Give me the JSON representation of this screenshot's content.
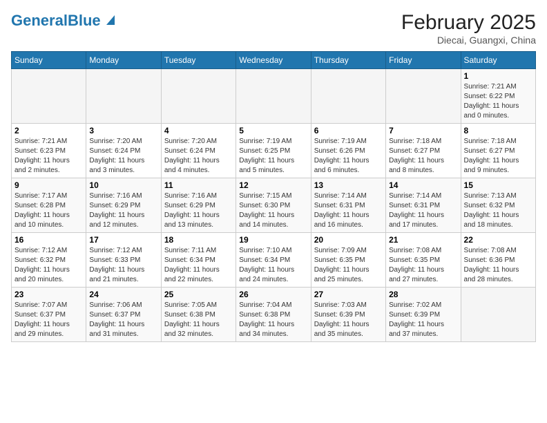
{
  "header": {
    "logo_line1": "General",
    "logo_line2": "Blue",
    "month_title": "February 2025",
    "location": "Diecai, Guangxi, China"
  },
  "days_of_week": [
    "Sunday",
    "Monday",
    "Tuesday",
    "Wednesday",
    "Thursday",
    "Friday",
    "Saturday"
  ],
  "weeks": [
    [
      {
        "day": "",
        "info": ""
      },
      {
        "day": "",
        "info": ""
      },
      {
        "day": "",
        "info": ""
      },
      {
        "day": "",
        "info": ""
      },
      {
        "day": "",
        "info": ""
      },
      {
        "day": "",
        "info": ""
      },
      {
        "day": "1",
        "info": "Sunrise: 7:21 AM\nSunset: 6:22 PM\nDaylight: 11 hours\nand 0 minutes."
      }
    ],
    [
      {
        "day": "2",
        "info": "Sunrise: 7:21 AM\nSunset: 6:23 PM\nDaylight: 11 hours\nand 2 minutes."
      },
      {
        "day": "3",
        "info": "Sunrise: 7:20 AM\nSunset: 6:24 PM\nDaylight: 11 hours\nand 3 minutes."
      },
      {
        "day": "4",
        "info": "Sunrise: 7:20 AM\nSunset: 6:24 PM\nDaylight: 11 hours\nand 4 minutes."
      },
      {
        "day": "5",
        "info": "Sunrise: 7:19 AM\nSunset: 6:25 PM\nDaylight: 11 hours\nand 5 minutes."
      },
      {
        "day": "6",
        "info": "Sunrise: 7:19 AM\nSunset: 6:26 PM\nDaylight: 11 hours\nand 6 minutes."
      },
      {
        "day": "7",
        "info": "Sunrise: 7:18 AM\nSunset: 6:27 PM\nDaylight: 11 hours\nand 8 minutes."
      },
      {
        "day": "8",
        "info": "Sunrise: 7:18 AM\nSunset: 6:27 PM\nDaylight: 11 hours\nand 9 minutes."
      }
    ],
    [
      {
        "day": "9",
        "info": "Sunrise: 7:17 AM\nSunset: 6:28 PM\nDaylight: 11 hours\nand 10 minutes."
      },
      {
        "day": "10",
        "info": "Sunrise: 7:16 AM\nSunset: 6:29 PM\nDaylight: 11 hours\nand 12 minutes."
      },
      {
        "day": "11",
        "info": "Sunrise: 7:16 AM\nSunset: 6:29 PM\nDaylight: 11 hours\nand 13 minutes."
      },
      {
        "day": "12",
        "info": "Sunrise: 7:15 AM\nSunset: 6:30 PM\nDaylight: 11 hours\nand 14 minutes."
      },
      {
        "day": "13",
        "info": "Sunrise: 7:14 AM\nSunset: 6:31 PM\nDaylight: 11 hours\nand 16 minutes."
      },
      {
        "day": "14",
        "info": "Sunrise: 7:14 AM\nSunset: 6:31 PM\nDaylight: 11 hours\nand 17 minutes."
      },
      {
        "day": "15",
        "info": "Sunrise: 7:13 AM\nSunset: 6:32 PM\nDaylight: 11 hours\nand 18 minutes."
      }
    ],
    [
      {
        "day": "16",
        "info": "Sunrise: 7:12 AM\nSunset: 6:32 PM\nDaylight: 11 hours\nand 20 minutes."
      },
      {
        "day": "17",
        "info": "Sunrise: 7:12 AM\nSunset: 6:33 PM\nDaylight: 11 hours\nand 21 minutes."
      },
      {
        "day": "18",
        "info": "Sunrise: 7:11 AM\nSunset: 6:34 PM\nDaylight: 11 hours\nand 22 minutes."
      },
      {
        "day": "19",
        "info": "Sunrise: 7:10 AM\nSunset: 6:34 PM\nDaylight: 11 hours\nand 24 minutes."
      },
      {
        "day": "20",
        "info": "Sunrise: 7:09 AM\nSunset: 6:35 PM\nDaylight: 11 hours\nand 25 minutes."
      },
      {
        "day": "21",
        "info": "Sunrise: 7:08 AM\nSunset: 6:35 PM\nDaylight: 11 hours\nand 27 minutes."
      },
      {
        "day": "22",
        "info": "Sunrise: 7:08 AM\nSunset: 6:36 PM\nDaylight: 11 hours\nand 28 minutes."
      }
    ],
    [
      {
        "day": "23",
        "info": "Sunrise: 7:07 AM\nSunset: 6:37 PM\nDaylight: 11 hours\nand 29 minutes."
      },
      {
        "day": "24",
        "info": "Sunrise: 7:06 AM\nSunset: 6:37 PM\nDaylight: 11 hours\nand 31 minutes."
      },
      {
        "day": "25",
        "info": "Sunrise: 7:05 AM\nSunset: 6:38 PM\nDaylight: 11 hours\nand 32 minutes."
      },
      {
        "day": "26",
        "info": "Sunrise: 7:04 AM\nSunset: 6:38 PM\nDaylight: 11 hours\nand 34 minutes."
      },
      {
        "day": "27",
        "info": "Sunrise: 7:03 AM\nSunset: 6:39 PM\nDaylight: 11 hours\nand 35 minutes."
      },
      {
        "day": "28",
        "info": "Sunrise: 7:02 AM\nSunset: 6:39 PM\nDaylight: 11 hours\nand 37 minutes."
      },
      {
        "day": "",
        "info": ""
      }
    ]
  ]
}
